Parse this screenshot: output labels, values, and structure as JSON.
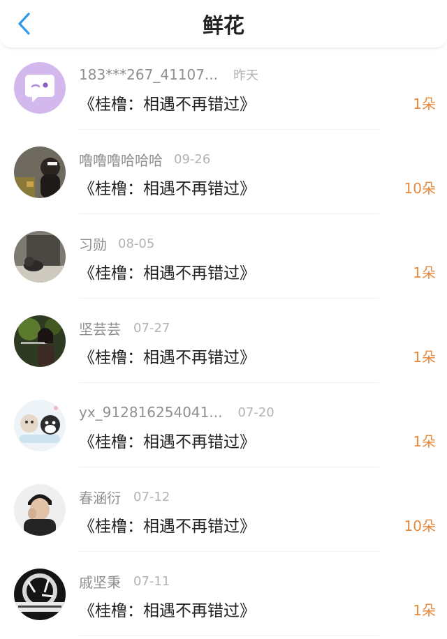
{
  "header": {
    "title": "鲜花",
    "back_icon": "chevron-left-icon",
    "accent_color": "#2f9ae8"
  },
  "rows": [
    {
      "name": "183***267_41107...",
      "date": "昨天",
      "gift": "《桂橹：相遇不再错过》",
      "count": "1朵",
      "avatar": "chat-bubble-icon"
    },
    {
      "name": "噜噜噜哈哈哈",
      "date": "09-26",
      "gift": "《桂橹：相遇不再错过》",
      "count": "10朵",
      "avatar": "user-photo"
    },
    {
      "name": "习勋",
      "date": "08-05",
      "gift": "《桂橹：相遇不再错过》",
      "count": "1朵",
      "avatar": "user-photo"
    },
    {
      "name": "坚芸芸",
      "date": "07-27",
      "gift": "《桂橹：相遇不再错过》",
      "count": "1朵",
      "avatar": "user-photo"
    },
    {
      "name": "yx_912816254041...",
      "date": "07-20",
      "gift": "《桂橹：相遇不再错过》",
      "count": "1朵",
      "avatar": "cartoon-cat-photo"
    },
    {
      "name": "春涵衍",
      "date": "07-12",
      "gift": "《桂橹：相遇不再错过》",
      "count": "10朵",
      "avatar": "user-photo"
    },
    {
      "name": "戚坚秉",
      "date": "07-11",
      "gift": "《桂橹：相遇不再错过》",
      "count": "1朵",
      "avatar": "user-photo"
    }
  ],
  "colors": {
    "count": "#e6893c",
    "name": "#8f8f8f",
    "date": "#b3b3b3"
  }
}
